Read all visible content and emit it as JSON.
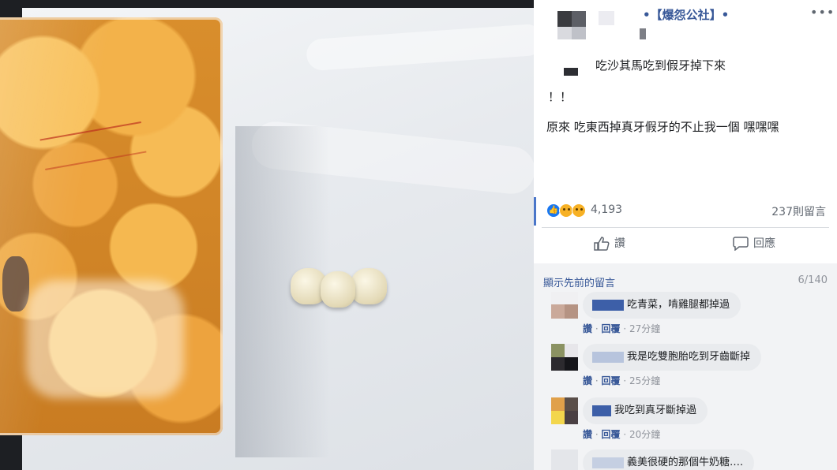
{
  "photo": {
    "description_icon": "photo-of-snack-bag-and-false-teeth"
  },
  "post": {
    "page_name": "•【爆怨公社】•",
    "more_icon": "•••",
    "text_line1": "吃沙其馬吃到假牙掉下來",
    "text_line2": "！！",
    "text_line3": "原來 吃東西掉真牙假牙的不止我一個 嘿嘿嘿",
    "reaction_count": "4,193",
    "comment_count": "237則留言",
    "like_label": "讚",
    "comment_label": "回應",
    "show_previous": "顯示先前的留言",
    "comment_progress": "6/140"
  },
  "comments": [
    {
      "text": "吃青菜，啃雞腿都掉過",
      "like": "讚",
      "reply": "回覆",
      "time": "27分鐘"
    },
    {
      "text": "我是吃雙胞胎吃到牙齒斷掉",
      "like": "讚",
      "reply": "回覆",
      "time": "25分鐘"
    },
    {
      "text": "我吃到真牙斷掉過",
      "like": "讚",
      "reply": "回覆",
      "time": "20分鐘"
    },
    {
      "text": "義美很硬的那個牛奶糖….",
      "like": "",
      "reply": "",
      "time": ""
    }
  ],
  "colors": {
    "link": "#385898",
    "meta": "#606770",
    "comment_bg": "#f2f3f5",
    "bubble_bg": "#e9ebee",
    "like_blue": "#1877f2"
  }
}
